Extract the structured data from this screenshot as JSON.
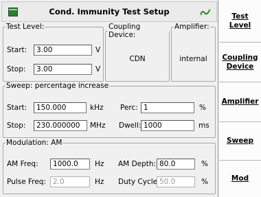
{
  "window": {
    "title": "Cond. Immunity Test Setup"
  },
  "test_level": {
    "legend": "Test Level:",
    "start_label": "Start:",
    "start_value": "3.00",
    "start_unit": "V",
    "stop_label": "Stop:",
    "stop_value": "3.00",
    "stop_unit": "V"
  },
  "coupling": {
    "legend": "Coupling Device:",
    "value": "CDN"
  },
  "amplifier": {
    "legend": "Amplifier:",
    "value": "internal"
  },
  "sweep": {
    "legend": "Sweep: percentage increase",
    "start_label": "Start:",
    "start_value": "150.000",
    "start_unit": "kHz",
    "stop_label": "Stop:",
    "stop_value": "230.000000",
    "stop_unit": "MHz",
    "perc_label": "Perc:",
    "perc_value": "1",
    "perc_unit": "%",
    "dwell_label": "Dwell:",
    "dwell_value": "1000",
    "dwell_unit": "ms"
  },
  "modulation": {
    "legend": "Modulation: AM",
    "am_freq_label": "AM Freq:",
    "am_freq_value": "1000.0",
    "am_freq_unit": "Hz",
    "am_depth_label": "AM Depth:",
    "am_depth_value": "80.0",
    "am_depth_unit": "%",
    "pulse_freq_label": "Pulse Freq:",
    "pulse_freq_value": "2.0",
    "pulse_freq_unit": "Hz",
    "duty_cycle_label": "Duty Cycle:",
    "duty_cycle_value": "50.0",
    "duty_cycle_unit": "%"
  },
  "tabs": [
    {
      "line1": "Test",
      "line2": "Level"
    },
    {
      "line1": "Coupling",
      "line2": "Device"
    },
    {
      "line1": "Amplifier",
      "line2": ""
    },
    {
      "line1": "Sweep",
      "line2": ""
    },
    {
      "line1": "Mod",
      "line2": ""
    }
  ],
  "colors": {
    "accent": "#2e7d32",
    "background": "#f0f0f0"
  },
  "icons": {
    "window": "app-square-icon",
    "logo": "brand-logo-icon"
  }
}
